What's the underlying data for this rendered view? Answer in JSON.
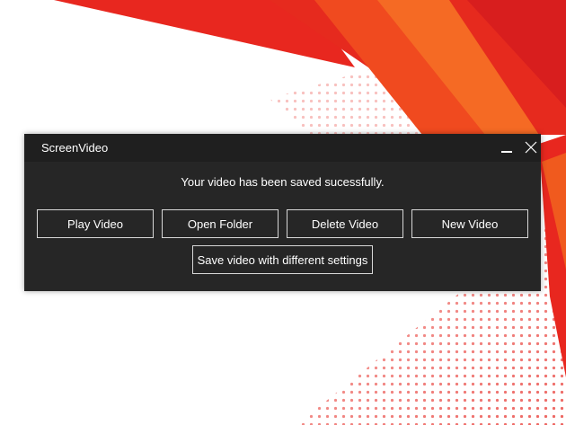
{
  "window": {
    "title": "ScreenVideo",
    "minimize_icon": "minimize-icon",
    "close_icon": "close-icon"
  },
  "message": "Your video has been saved sucessfully.",
  "buttons": {
    "play": "Play Video",
    "open_folder": "Open Folder",
    "delete": "Delete Video",
    "new": "New Video",
    "different_settings": "Save video with different settings"
  },
  "colors": {
    "accent_red": "#e8271f",
    "accent_orange": "#f05a1e",
    "dialog_bg": "#262626",
    "titlebar_bg": "#1f1f1f"
  }
}
